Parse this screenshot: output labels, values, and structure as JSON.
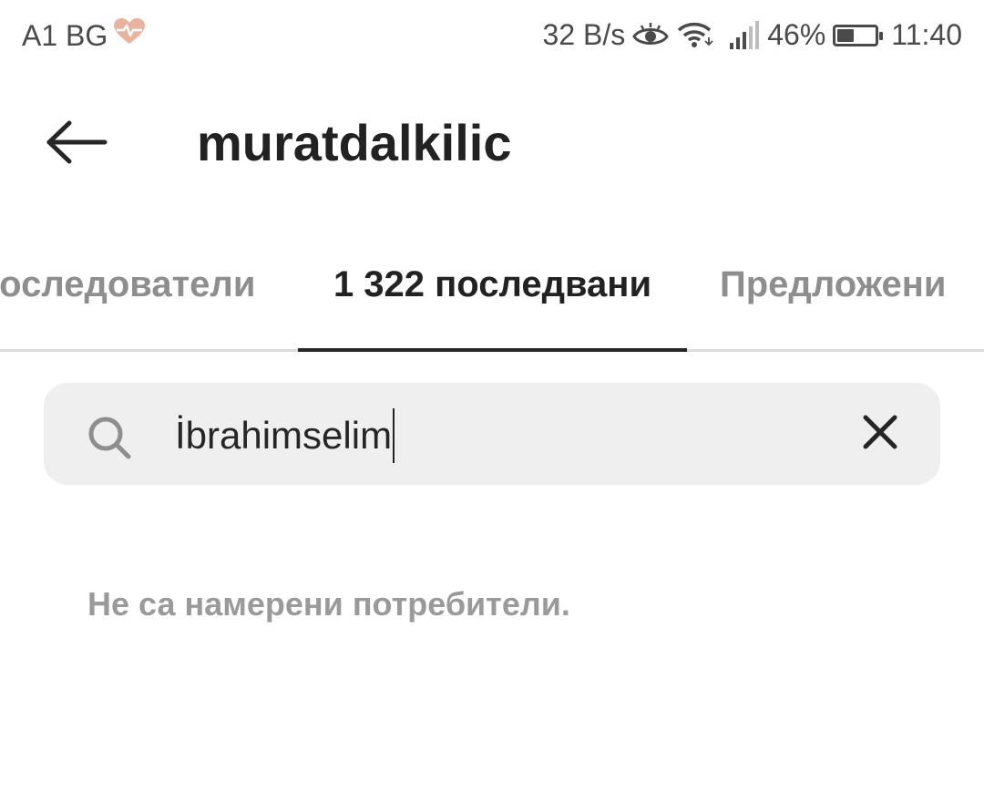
{
  "status_bar": {
    "carrier": "A1 BG",
    "speed": "32 B/s",
    "battery": "46%",
    "battery_level": 0.46,
    "time": "11:40",
    "icons": [
      "health-heart-icon",
      "eye-icon",
      "wifi-icon",
      "signal-icon",
      "battery-icon"
    ]
  },
  "header": {
    "title": "muratdalkilic",
    "back_icon": "arrow-left-icon"
  },
  "tabs": [
    {
      "label": "последователи",
      "active": false
    },
    {
      "label": "1 322 последвани",
      "active": true
    },
    {
      "label": "Предложени",
      "active": false
    }
  ],
  "search": {
    "value": "İbrahimselim",
    "icon": "search-icon",
    "clear_icon": "close-icon"
  },
  "results": {
    "empty_message": "Не са намерени потребители."
  },
  "colors": {
    "text_primary": "#222222",
    "text_secondary": "#8e8e8e",
    "search_bg": "#efefef",
    "divider": "#dbdbdb",
    "heart": "#e8b4a0"
  }
}
